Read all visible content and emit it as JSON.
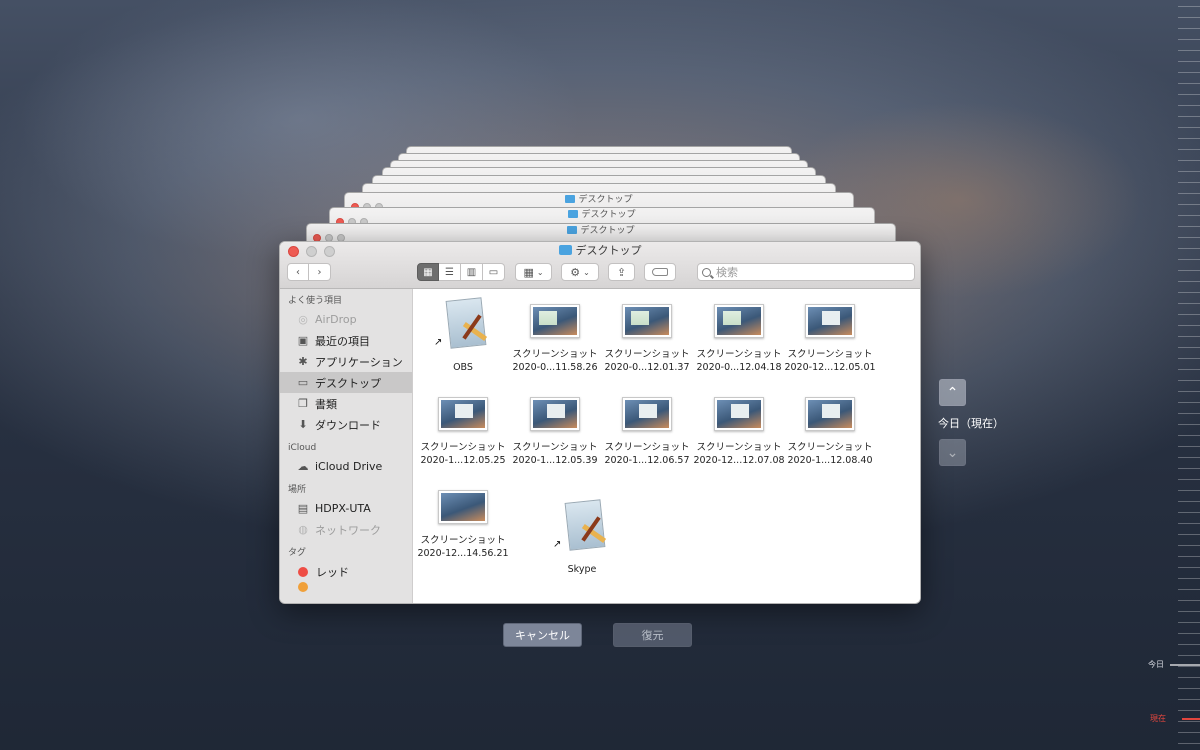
{
  "window": {
    "title": "デスクトップ"
  },
  "stack_titles": [
    "デスクトップ",
    "デスクトップ",
    "デスクトップ"
  ],
  "search": {
    "placeholder": "検索"
  },
  "sidebar": {
    "favorites_heading": "よく使う項目",
    "favorites": [
      {
        "label": "AirDrop",
        "icon": "airdrop-icon",
        "dim": true
      },
      {
        "label": "最近の項目",
        "icon": "recents-icon"
      },
      {
        "label": "アプリケーション",
        "icon": "applications-icon"
      },
      {
        "label": "デスクトップ",
        "icon": "desktop-icon",
        "selected": true
      },
      {
        "label": "書類",
        "icon": "documents-icon"
      },
      {
        "label": "ダウンロード",
        "icon": "downloads-icon"
      }
    ],
    "icloud_heading": "iCloud",
    "icloud": [
      {
        "label": "iCloud Drive",
        "icon": "cloud-icon"
      }
    ],
    "locations_heading": "場所",
    "locations": [
      {
        "label": "HDPX-UTA",
        "icon": "drive-icon"
      },
      {
        "label": "ネットワーク",
        "icon": "network-icon",
        "dim": true
      }
    ],
    "tags_heading": "タグ",
    "tags": [
      {
        "label": "レッド",
        "color": "#ee4d45"
      }
    ]
  },
  "files": [
    {
      "name1": "OBS",
      "name2": "",
      "kind": "app"
    },
    {
      "name1": "スクリーンショット",
      "name2": "2020-0...11.58.26",
      "kind": "shot-green"
    },
    {
      "name1": "スクリーンショット",
      "name2": "2020-0...12.01.37",
      "kind": "shot-green"
    },
    {
      "name1": "スクリーンショット",
      "name2": "2020-0...12.04.18",
      "kind": "shot-green"
    },
    {
      "name1": "スクリーンショット",
      "name2": "2020-12...12.05.01",
      "kind": "shot"
    },
    {
      "name1": "スクリーンショット",
      "name2": "2020-1...12.05.25",
      "kind": "shot"
    },
    {
      "name1": "スクリーンショット",
      "name2": "2020-1...12.05.39",
      "kind": "shot"
    },
    {
      "name1": "スクリーンショット",
      "name2": "2020-1...12.06.57",
      "kind": "shot"
    },
    {
      "name1": "スクリーンショット",
      "name2": "2020-12...12.07.08",
      "kind": "shot"
    },
    {
      "name1": "スクリーンショット",
      "name2": "2020-1...12.08.40",
      "kind": "shot"
    },
    {
      "name1": "スクリーンショット",
      "name2": "2020-12...14.56.21",
      "kind": "shot-plain"
    },
    {
      "name1": "Skype",
      "name2": "",
      "kind": "app"
    }
  ],
  "buttons": {
    "cancel": "キャンセル",
    "restore": "復元"
  },
  "time_machine": {
    "current_label": "今日（現在）",
    "timeline_today": "今日",
    "timeline_now": "現在"
  },
  "colors": {
    "accent_now": "#e2463e",
    "folder": "#4aa3e0"
  }
}
